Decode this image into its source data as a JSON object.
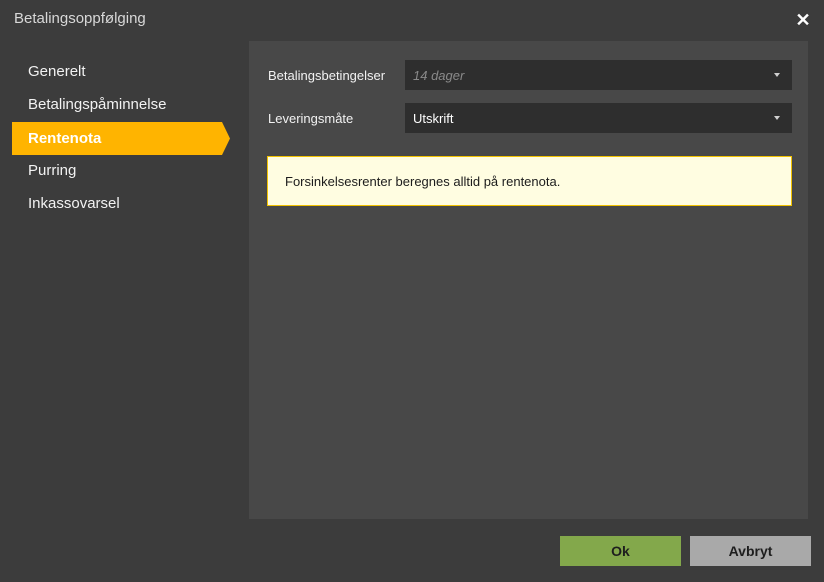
{
  "window": {
    "title": "Betalingsoppfølging",
    "close_icon": "close-icon"
  },
  "sidebar": {
    "items": [
      {
        "label": "Generelt",
        "active": false
      },
      {
        "label": "Betalingspåminnelse",
        "active": false
      },
      {
        "label": "Rentenota",
        "active": true
      },
      {
        "label": "Purring",
        "active": false
      },
      {
        "label": "Inkassovarsel",
        "active": false
      }
    ]
  },
  "form": {
    "payment_terms": {
      "label": "Betalingsbetingelser",
      "value": "14 dager",
      "disabled": true
    },
    "delivery_method": {
      "label": "Leveringsmåte",
      "value": "Utskrift"
    }
  },
  "notice": {
    "text": "Forsinkelsesrenter beregnes alltid på rentenota."
  },
  "buttons": {
    "ok_label": "Ok",
    "cancel_label": "Avbryt"
  },
  "colors": {
    "active_nav": "#ffb400",
    "ok_button": "#83a84b",
    "cancel_button": "#a9a9a9",
    "notice_bg": "#fffde1",
    "notice_border": "#f2c200"
  }
}
